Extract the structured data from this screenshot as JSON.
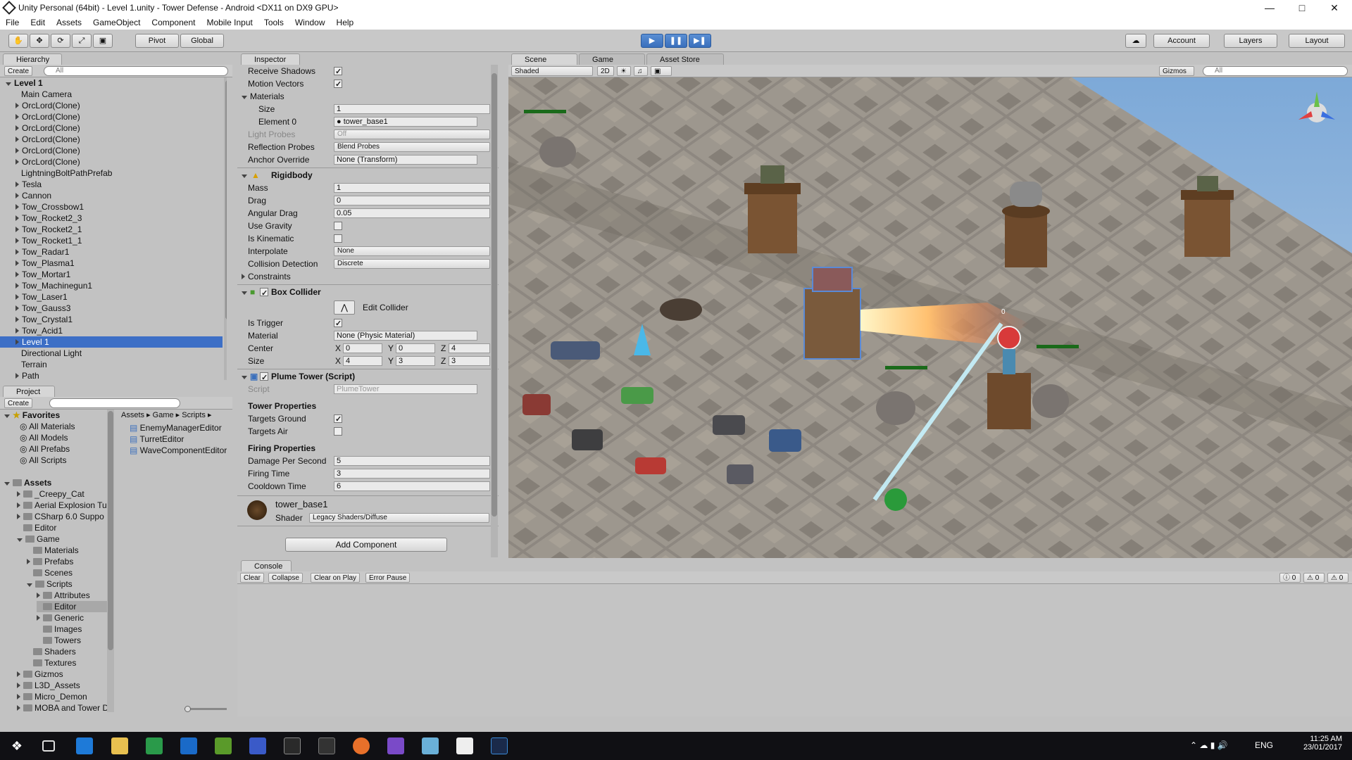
{
  "window": {
    "title": "Unity Personal (64bit) - Level 1.unity - Tower Defense - Android <DX11 on DX9 GPU>"
  },
  "menu": [
    "File",
    "Edit",
    "Assets",
    "GameObject",
    "Component",
    "Mobile Input",
    "Tools",
    "Window",
    "Help"
  ],
  "toolbar": {
    "pivot": "Pivot",
    "global": "Global",
    "account": "Account",
    "layers": "Layers",
    "layout": "Layout"
  },
  "hierarchy": {
    "tab": "Hierarchy",
    "create": "Create",
    "search": "All",
    "scene": "Level 1",
    "items": [
      "Main Camera",
      "OrcLord(Clone)",
      "OrcLord(Clone)",
      "OrcLord(Clone)",
      "OrcLord(Clone)",
      "OrcLord(Clone)",
      "OrcLord(Clone)",
      "LightningBoltPathPrefab",
      "Tesla",
      "Cannon",
      "Tow_Crossbow1",
      "Tow_Rocket2_3",
      "Tow_Rocket2_1",
      "Tow_Rocket1_1",
      "Tow_Radar1",
      "Tow_Plasma1",
      "Tow_Mortar1",
      "Tow_Machinegun1",
      "Tow_Laser1",
      "Tow_Gauss3",
      "Tow_Crystal1",
      "Tow_Acid1",
      "Level 1",
      "Directional Light",
      "Terrain",
      "Path"
    ]
  },
  "project": {
    "tab": "Project",
    "create": "Create",
    "favorites": "Favorites",
    "fav_items": [
      "All Materials",
      "All Models",
      "All Prefabs",
      "All Scripts"
    ],
    "assets": "Assets",
    "tree": [
      "_Creepy_Cat",
      "Aerial Explosion Tu",
      "CSharp 6.0 Suppo",
      "Editor",
      "Game",
      "Materials",
      "Prefabs",
      "Scenes",
      "Scripts",
      "Attributes",
      "Editor",
      "Generic",
      "Images",
      "Towers",
      "Shaders",
      "Textures",
      "Gizmos",
      "L3D_Assets",
      "Micro_Demon",
      "MOBA and Tower D"
    ],
    "breadcrumb": [
      "Assets",
      "Game",
      "Scripts"
    ],
    "files": [
      "EnemyManagerEditor",
      "TurretEditor",
      "WaveComponentEditor"
    ]
  },
  "inspector": {
    "tab": "Inspector",
    "renderer": {
      "receive_shadows": "Receive Shadows",
      "motion_vectors": "Motion Vectors",
      "materials": "Materials",
      "size_label": "Size",
      "size": "1",
      "element0_label": "Element 0",
      "element0": "tower_base1",
      "light_probes_label": "Light Probes",
      "light_probes": "Off",
      "reflection_label": "Reflection Probes",
      "reflection": "Blend Probes",
      "anchor_label": "Anchor Override",
      "anchor": "None (Transform)"
    },
    "rigidbody": {
      "title": "Rigidbody",
      "mass_label": "Mass",
      "mass": "1",
      "drag_label": "Drag",
      "drag": "0",
      "ang_label": "Angular Drag",
      "ang": "0.05",
      "gravity_label": "Use Gravity",
      "kinematic_label": "Is Kinematic",
      "interp_label": "Interpolate",
      "interp": "None",
      "coll_label": "Collision Detection",
      "coll": "Discrete",
      "constraints": "Constraints"
    },
    "box": {
      "title": "Box Collider",
      "edit": "Edit Collider",
      "trigger_label": "Is Trigger",
      "material_label": "Material",
      "material": "None (Physic Material)",
      "center_label": "Center",
      "size_label": "Size",
      "cx": "0",
      "cy": "0",
      "cz": "4",
      "sx": "4",
      "sy": "3",
      "sz": "3",
      "x": "X",
      "y": "Y",
      "z": "Z"
    },
    "plume": {
      "title": "Plume Tower (Script)",
      "script_label": "Script",
      "script": "PlumeTower",
      "tower_props": "Tower Properties",
      "ground_label": "Targets Ground",
      "air_label": "Targets Air",
      "firing_props": "Firing Properties",
      "dps_label": "Damage Per Second",
      "dps": "5",
      "ftime_label": "Firing Time",
      "ftime": "3",
      "cool_label": "Cooldown Time",
      "cool": "6"
    },
    "material": {
      "name": "tower_base1",
      "shader_label": "Shader",
      "shader": "Legacy Shaders/Diffuse"
    },
    "add": "Add Component"
  },
  "scene": {
    "tabs": [
      "Scene",
      "Game",
      "Asset Store"
    ],
    "shaded": "Shaded",
    "twod": "2D",
    "gizmos": "Gizmos",
    "search": "All",
    "marker": "0"
  },
  "console": {
    "tab": "Console",
    "buttons": [
      "Clear",
      "Collapse",
      "Clear on Play",
      "Error Pause"
    ],
    "counts": [
      "0",
      "0",
      "0"
    ]
  },
  "taskbar": {
    "lang": "ENG",
    "time": "11:25 AM",
    "date": "23/01/2017"
  }
}
